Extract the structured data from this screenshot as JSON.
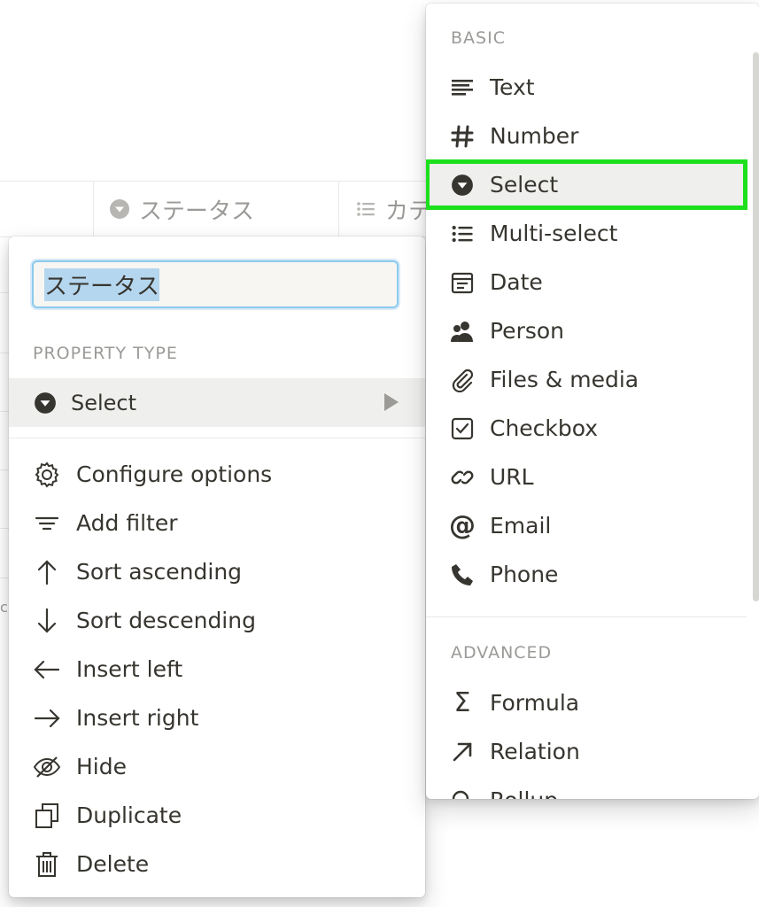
{
  "table": {
    "columns": [
      {
        "label": "ステータス",
        "icon": "select-icon"
      },
      {
        "label": "カテ",
        "icon": "multi-select-icon"
      }
    ],
    "stray_text": "c"
  },
  "property_menu": {
    "name_value": "ステータス",
    "section_label": "PROPERTY TYPE",
    "type": {
      "label": "Select",
      "icon": "select-icon"
    },
    "items": [
      {
        "label": "Configure options",
        "icon": "gear-icon"
      },
      {
        "label": "Add filter",
        "icon": "filter-icon"
      },
      {
        "label": "Sort ascending",
        "icon": "arrow-up-icon"
      },
      {
        "label": "Sort descending",
        "icon": "arrow-down-icon"
      },
      {
        "label": "Insert left",
        "icon": "arrow-left-icon"
      },
      {
        "label": "Insert right",
        "icon": "arrow-right-icon"
      },
      {
        "label": "Hide",
        "icon": "eye-off-icon"
      },
      {
        "label": "Duplicate",
        "icon": "duplicate-icon"
      },
      {
        "label": "Delete",
        "icon": "trash-icon"
      }
    ]
  },
  "type_menu": {
    "basic_label": "BASIC",
    "advanced_label": "ADVANCED",
    "basic": [
      {
        "label": "Text",
        "icon": "text-icon"
      },
      {
        "label": "Number",
        "icon": "number-icon"
      },
      {
        "label": "Select",
        "icon": "select-icon",
        "selected": true
      },
      {
        "label": "Multi-select",
        "icon": "multi-select-icon"
      },
      {
        "label": "Date",
        "icon": "calendar-icon"
      },
      {
        "label": "Person",
        "icon": "person-icon"
      },
      {
        "label": "Files & media",
        "icon": "paperclip-icon"
      },
      {
        "label": "Checkbox",
        "icon": "checkbox-icon"
      },
      {
        "label": "URL",
        "icon": "link-icon"
      },
      {
        "label": "Email",
        "icon": "at-icon"
      },
      {
        "label": "Phone",
        "icon": "phone-icon"
      }
    ],
    "advanced": [
      {
        "label": "Formula",
        "icon": "sigma-icon"
      },
      {
        "label": "Relation",
        "icon": "arrow-up-right-icon"
      },
      {
        "label": "Rollup",
        "icon": "search-icon"
      }
    ]
  },
  "colors": {
    "text": "#37352f",
    "muted": "#9b9a97",
    "hover": "#efefed",
    "highlight_outline": "#1de01d",
    "focus_ring": "#8ccbec"
  }
}
